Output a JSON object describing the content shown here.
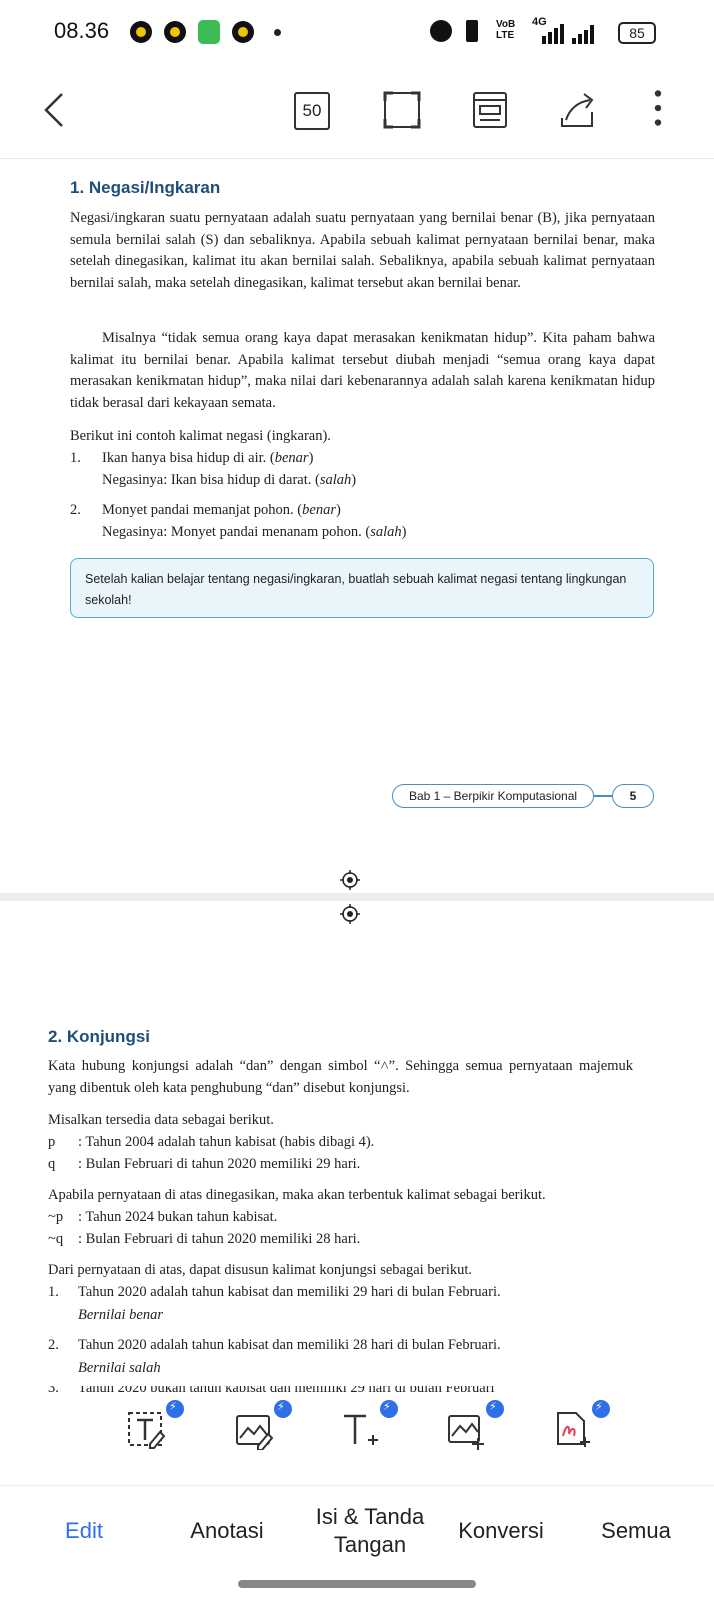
{
  "status_bar": {
    "time": "08.36",
    "network": "4G",
    "volte": "VoB LTE",
    "battery": "85"
  },
  "toolbar": {
    "page_count": "50"
  },
  "page1": {
    "heading": "1.   Negasi/Ingkaran",
    "para1": "Negasi/ingkaran suatu pernyataan adalah suatu pernyataan yang bernilai benar (B), jika pernyataan semula bernilai salah (S) dan sebaliknya. Apabila sebuah kalimat pernyataan bernilai benar, maka setelah dinegasikan, kalimat itu akan bernilai salah. Sebaliknya, apabila sebuah kalimat pernyataan bernilai salah, maka setelah dinegasikan, kalimat tersebut akan bernilai benar.",
    "para2": "Misalnya “tidak semua orang kaya dapat merasakan kenikmatan hidup”. Kita paham bahwa kalimat itu bernilai benar. Apabila kalimat tersebut diubah menjadi “semua orang kaya dapat merasakan kenikmatan hidup”, maka nilai dari kebenarannya adalah salah karena kenikmatan hidup tidak berasal dari kekayaan semata.",
    "intro": "Berikut ini contoh kalimat negasi (ingkaran).",
    "items": [
      {
        "num": "1.",
        "line1": "Ikan hanya bisa hidup di air. (",
        "tag1": "benar",
        "line2": "Negasinya: Ikan bisa hidup di darat. (",
        "tag2": "salah"
      },
      {
        "num": "2.",
        "line1": "Monyet pandai memanjat pohon. (",
        "tag1": "benar",
        "line2": "Negasinya: Monyet pandai menanam pohon. (",
        "tag2": "salah"
      }
    ],
    "note": "Setelah kalian belajar tentang negasi/ingkaran, buatlah sebuah kalimat negasi tentang lingkungan sekolah!",
    "footer_chapter": "Bab 1 – Berpikir Komputasional",
    "footer_page": "5"
  },
  "page2": {
    "heading": "2.   Konjungsi",
    "para1": "Kata hubung konjungsi adalah “dan” dengan simbol “˄”. Sehingga semua pernyataan majemuk yang dibentuk oleh kata penghubung “dan” disebut konjungsi.",
    "intro1": "Misalkan tersedia data sebagai berikut.",
    "defs1": [
      {
        "sym": "p",
        "text": ": Tahun 2004 adalah tahun kabisat (habis dibagi 4)."
      },
      {
        "sym": "q",
        "text": ": Bulan Februari di tahun 2020 memiliki 29 hari."
      }
    ],
    "intro2": "Apabila pernyataan di atas dinegasikan, maka akan terbentuk kalimat sebagai berikut.",
    "defs2": [
      {
        "sym": "~p",
        "text": ": Tahun 2024 bukan tahun kabisat."
      },
      {
        "sym": "~q",
        "text": ": Bulan Februari di tahun 2020 memiliki 28 hari."
      }
    ],
    "intro3": "Dari pernyataan di atas, dapat disusun kalimat konjungsi sebagai berikut.",
    "items": [
      {
        "num": "1.",
        "text": "Tahun 2020 adalah tahun kabisat dan memiliki 29 hari di bulan Februari.",
        "value": "Bernilai benar"
      },
      {
        "num": "2.",
        "text": "Tahun 2020 adalah tahun kabisat dan memiliki 28 hari di bulan Februari.",
        "value": "Bernilai salah"
      },
      {
        "num": "3.",
        "text": "Tahun 2020 bukan tahun kabisat dan memiliki 29 hari di bulan Februari"
      }
    ]
  },
  "bottom_nav": {
    "edit": "Edit",
    "annotate": "Anotasi",
    "fill_sign": "Isi & Tanda Tangan",
    "convert": "Konversi",
    "all": "Semua"
  },
  "colors": {
    "accent": "#2f6fe8",
    "heading": "#1f4e79",
    "note_bg": "#e9f5fb",
    "note_border": "#5aa8cc",
    "edit_active": "#2f6fe8"
  }
}
